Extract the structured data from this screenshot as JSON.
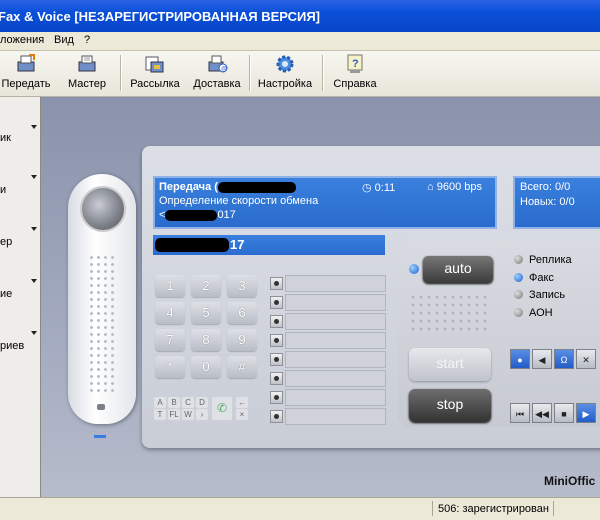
{
  "window": {
    "title": "Fax & Voice [НЕЗАРЕГИСТРИРОВАННАЯ ВЕРСИЯ]"
  },
  "menu": {
    "items": [
      "ложения",
      "Вид",
      "?"
    ]
  },
  "toolbar": {
    "buttons": [
      {
        "label": "Передать",
        "icon": "send-fax-icon"
      },
      {
        "label": "Мастер",
        "icon": "wizard-fax-icon"
      },
      {
        "label": "Рассылка",
        "icon": "mailing-icon"
      },
      {
        "label": "Доставка",
        "icon": "delivery-icon"
      },
      {
        "label": "Настройка",
        "icon": "gear-icon"
      },
      {
        "label": "Справка",
        "icon": "help-icon"
      }
    ]
  },
  "sidebar": {
    "items": [
      {
        "label": "ик"
      },
      {
        "label": "и"
      },
      {
        "label": "ер"
      },
      {
        "label": "ие"
      },
      {
        "label": "риев"
      }
    ]
  },
  "lcd": {
    "line1_prefix": "Передача (",
    "line1_time": "0:11",
    "line1_speed": "9600 bps",
    "line2": "Определение скорости обмена",
    "line3_prefix": "<",
    "line3_suffix": "017"
  },
  "counters": {
    "total": "Всего: 0/0",
    "new": "Новых: 0/0"
  },
  "number_field": {
    "suffix": "17"
  },
  "keypad": {
    "keys": [
      "1",
      "2",
      "3",
      "4",
      "5",
      "6",
      "7",
      "8",
      "9",
      "*",
      "0",
      "#"
    ],
    "letters": [
      "A",
      "B",
      "C",
      "D",
      "T",
      "FL",
      "W",
      "›"
    ],
    "extra": [
      "←",
      "×"
    ]
  },
  "memory": {
    "rows": 8
  },
  "controls": {
    "auto_label": "auto",
    "start_label": "start",
    "stop_label": "stop",
    "modes": [
      {
        "label": "Реплика",
        "on": false
      },
      {
        "label": "Факс",
        "on": true
      },
      {
        "label": "Запись",
        "on": false
      },
      {
        "label": "АОН",
        "on": false
      }
    ]
  },
  "brand": "MiniOffic",
  "status": {
    "text": "506: зарегистрирован"
  }
}
